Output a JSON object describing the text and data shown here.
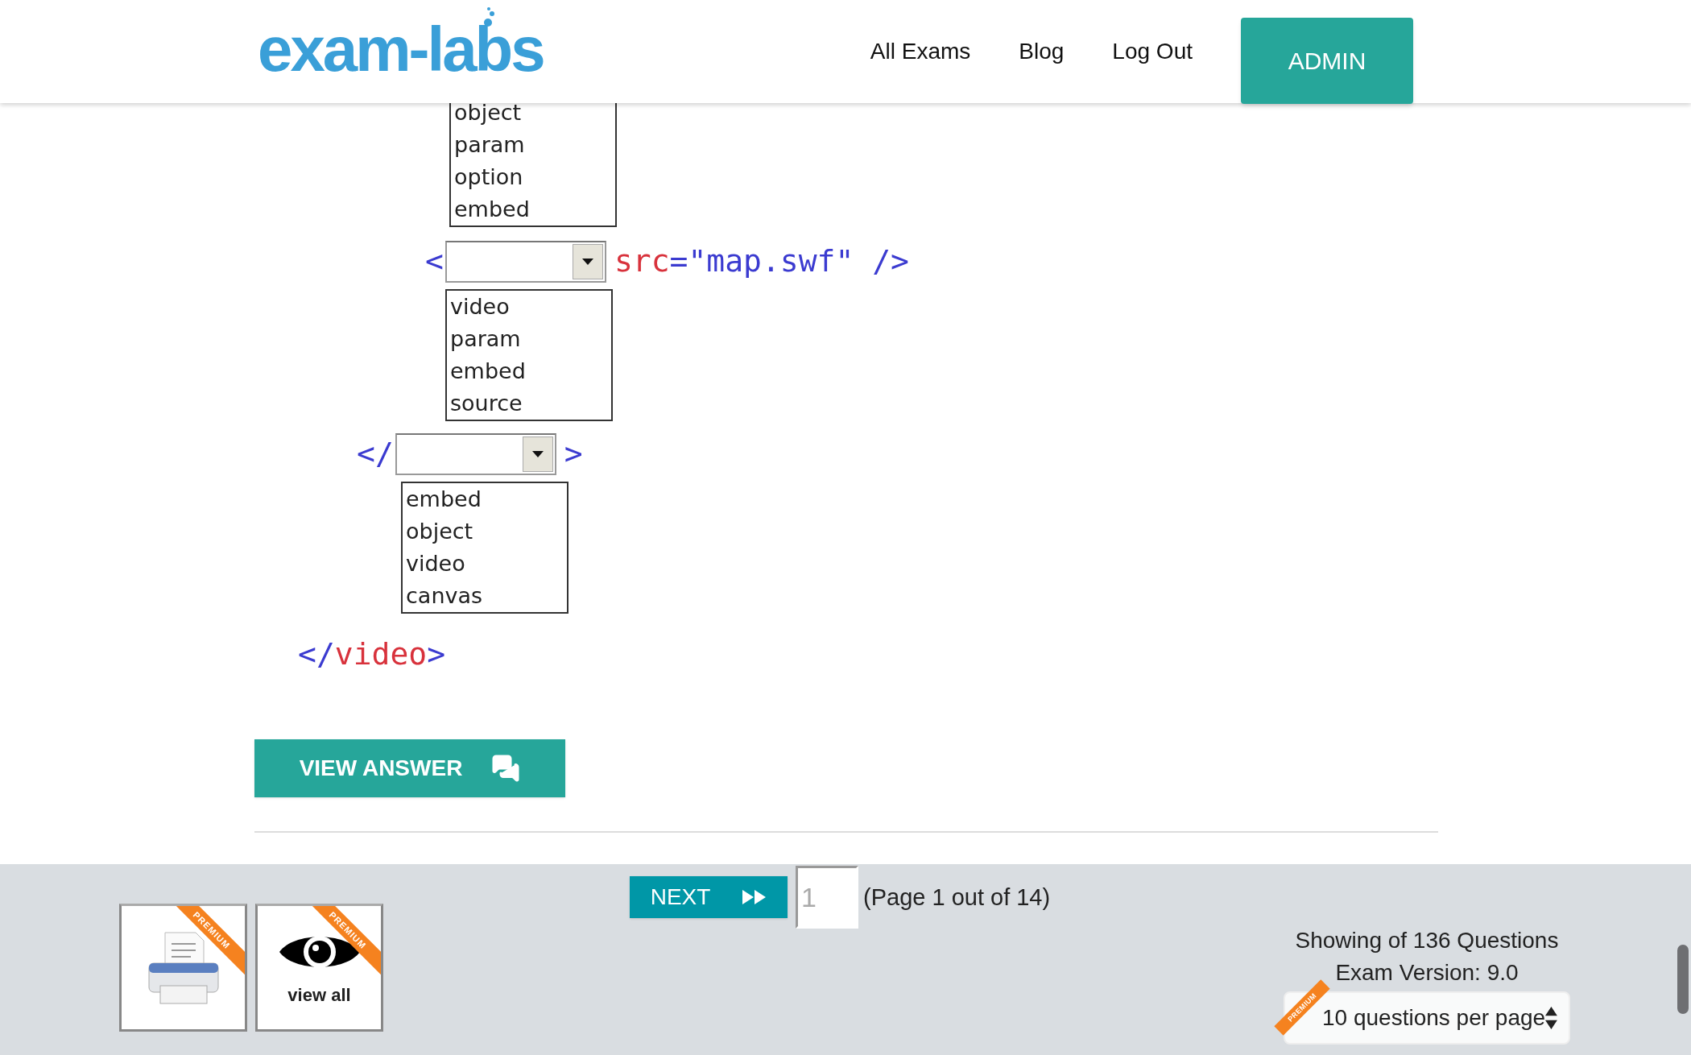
{
  "header": {
    "logo": "exam-labs",
    "nav": [
      "All Exams",
      "Blog",
      "Log Out"
    ],
    "admin_button": "ADMIN"
  },
  "question_image": [
    {
      "kind": "list",
      "options": [
        "object",
        "param",
        "option",
        "embed"
      ]
    },
    {
      "kind": "select_line",
      "before": [
        {
          "kind": "markup",
          "text": "<"
        }
      ],
      "after": [
        {
          "kind": "name",
          "text": "src"
        },
        {
          "kind": "markup",
          "text": "=\"map.swf\" />"
        }
      ]
    },
    {
      "kind": "list",
      "options": [
        "video",
        "param",
        "embed",
        "source"
      ]
    },
    {
      "kind": "select_line",
      "before": [
        {
          "kind": "markup",
          "text": "</"
        }
      ],
      "after": [
        {
          "kind": "markup",
          "text": ">"
        }
      ]
    },
    {
      "kind": "list",
      "options": [
        "embed",
        "object",
        "video",
        "canvas"
      ]
    },
    {
      "kind": "tag",
      "parts": [
        {
          "kind": "markup",
          "text": "</"
        },
        {
          "kind": "name",
          "text": "video"
        },
        {
          "kind": "markup",
          "text": ">"
        }
      ]
    }
  ],
  "view_answer_button": "VIEW ANSWER",
  "footer": {
    "tools": [
      {
        "kind": "print",
        "badge": "PREMIUM"
      },
      {
        "kind": "view",
        "label": "view all",
        "badge": "PREMIUM"
      }
    ],
    "next_button": "NEXT",
    "page_field": {
      "value": "1"
    },
    "page_info": "(Page 1 out of 14)",
    "showing": "Showing of 136 Questions",
    "version": "Exam Version: 9.0",
    "per_page": {
      "value": "10 questions per page",
      "badge": "PREMIUM"
    }
  }
}
